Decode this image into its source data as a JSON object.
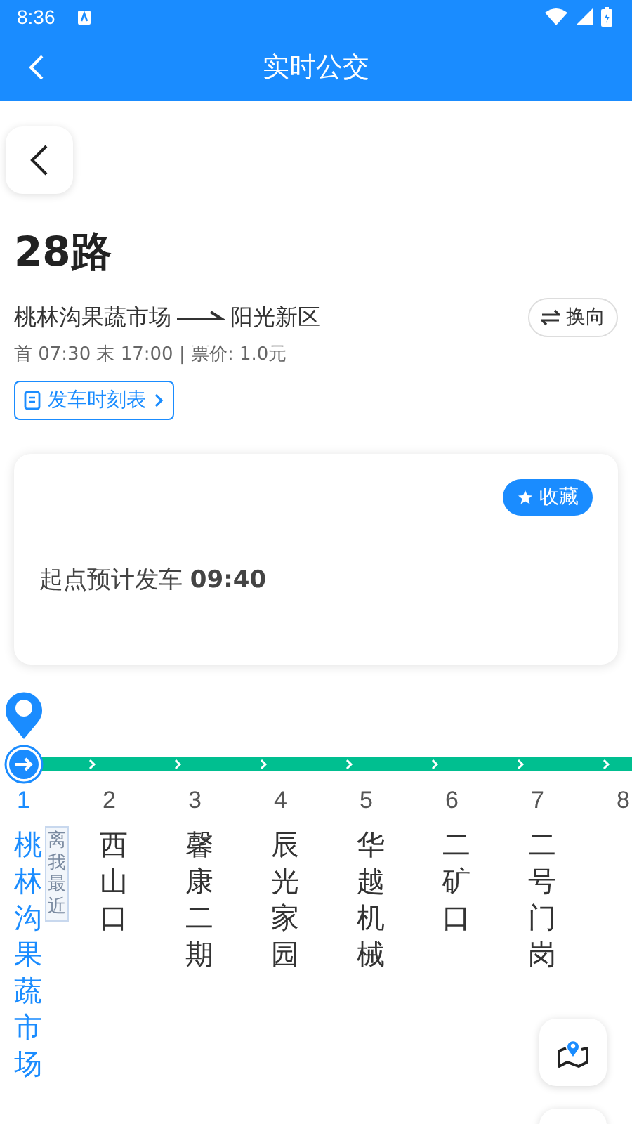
{
  "status_bar": {
    "time": "8:36"
  },
  "header": {
    "title": "实时公交"
  },
  "route": {
    "name": "28路",
    "from": "桃林沟果蔬市场",
    "to": "阳光新区",
    "swap_label": "换向",
    "hours": "首 07:30 末 17:00 | 票价: 1.0元",
    "timetable_label": "发车时刻表"
  },
  "departure_card": {
    "favorite_label": "收藏",
    "text": "起点预计发车 **09:40**"
  },
  "stops": [
    {
      "number": "1",
      "name": "桃林沟果蔬市场",
      "selected": true,
      "badge": "离我最近"
    },
    {
      "number": "2",
      "name": "西山口",
      "selected": false
    },
    {
      "number": "3",
      "name": "馨康二期",
      "selected": false
    },
    {
      "number": "4",
      "name": "辰光家园",
      "selected": false
    },
    {
      "number": "5",
      "name": "华越机械",
      "selected": false
    },
    {
      "number": "6",
      "name": "二矿口",
      "selected": false
    },
    {
      "number": "7",
      "name": "二号门岗",
      "selected": false
    },
    {
      "number": "8",
      "selected": false
    }
  ]
}
